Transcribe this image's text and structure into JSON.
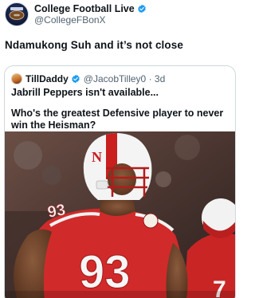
{
  "tweet": {
    "display_name": "College Football Live",
    "handle": "@CollegeFBonX",
    "text": "Ndamukong Suh and it’s not close"
  },
  "quoted": {
    "display_name": "TillDaddy",
    "handle_time": "@JacobTilley0 · 3d",
    "line1": "Jabrill Peppers isn't available...",
    "line2": "Who's the greatest Defensive player to never win the Heisman?"
  },
  "media": {
    "jersey_number": "93",
    "jersey_number_back": "7",
    "helmet_letter": "N"
  },
  "colors": {
    "verified": "#1d9bf0",
    "jersey_red": "#d12a2a",
    "helmet_white": "#f4f4f4"
  },
  "icons": {
    "verified": "verified-badge-icon",
    "avatar": "college-football-logo"
  }
}
